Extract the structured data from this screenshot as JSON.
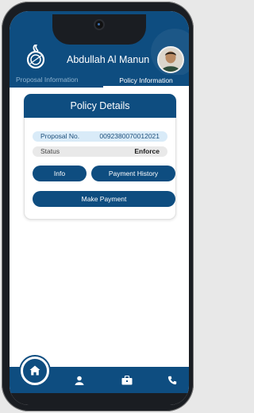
{
  "header": {
    "user_name": "Abdullah Al Manun",
    "tabs": [
      {
        "label": "Proposal Information",
        "active": false
      },
      {
        "label": "Policy Information",
        "active": true
      }
    ]
  },
  "card": {
    "title": "Policy Details",
    "rows": [
      {
        "label": "Proposal No.",
        "value": "0092380070012021"
      },
      {
        "label": "Status",
        "value": "Enforce"
      }
    ],
    "buttons": {
      "info": "Info",
      "history": "Payment History",
      "pay": "Make Payment"
    }
  },
  "bottom_nav": {
    "icons": [
      "home-icon",
      "user-icon",
      "briefcase-icon",
      "phone-icon"
    ],
    "active": "home-icon"
  },
  "colors": {
    "primary": "#0e4d80",
    "proposal_row": "#d9ebf8",
    "status_row": "#e9e9e9"
  }
}
